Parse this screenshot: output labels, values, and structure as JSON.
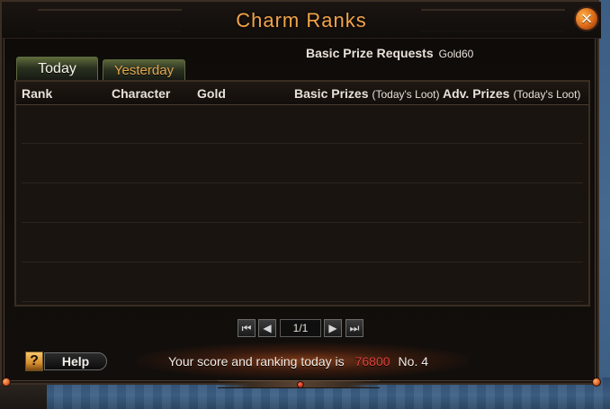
{
  "window": {
    "title": "Charm Ranks",
    "close_icon": "×"
  },
  "requests": {
    "label": "Basic Prize Requests",
    "value": "Gold60"
  },
  "tabs": [
    {
      "label": "Today",
      "active": true
    },
    {
      "label": "Yesterday",
      "active": false
    }
  ],
  "table": {
    "columns": {
      "rank": "Rank",
      "character": "Character",
      "gold": "Gold",
      "basic_prizes": "Basic Prizes",
      "basic_prizes_sub": "(Today's Loot)",
      "adv_prizes": "Adv. Prizes",
      "adv_prizes_sub": "(Today's Loot)"
    },
    "rows": []
  },
  "pagination": {
    "label": "1/1",
    "first_icon": "⏮",
    "prev_icon": "◀",
    "next_icon": "▶",
    "last_icon": "⏭"
  },
  "help": {
    "icon": "?",
    "label": "Help"
  },
  "status": {
    "prefix": "Your score and ranking today is",
    "score": "76800",
    "rank": "No. 4"
  },
  "colors": {
    "title": "#f0a44b",
    "accent": "#e0403a",
    "panel_bg": "#120e0b"
  }
}
